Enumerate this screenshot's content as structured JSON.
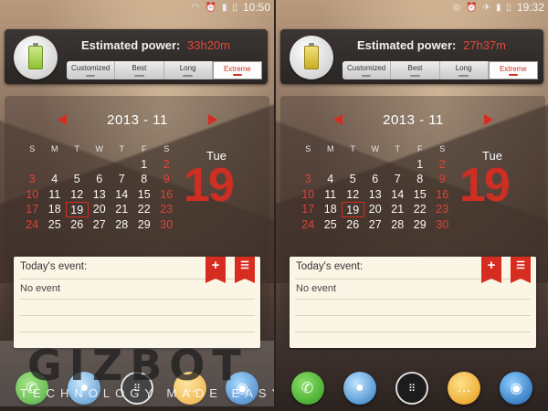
{
  "screens": [
    {
      "status": {
        "time": "10:50"
      },
      "power": {
        "label": "Estimated power:",
        "value": "33h20m",
        "battery_color": "green"
      },
      "modes": [
        "Customized",
        "Best",
        "Long",
        "Extreme"
      ],
      "active_mode": "Extreme",
      "calendar": {
        "month_label": "2013 - 11",
        "weekdays": [
          "S",
          "M",
          "T",
          "W",
          "T",
          "F",
          "S"
        ],
        "day_name": "Tue",
        "day_number": "19"
      },
      "events": {
        "title": "Today's event:",
        "empty_text": "No event",
        "add_icon": "+",
        "list_icon": "☰"
      }
    },
    {
      "status": {
        "time": "19:32"
      },
      "power": {
        "label": "Estimated power:",
        "value": "27h37m",
        "battery_color": "yellow"
      },
      "modes": [
        "Customized",
        "Best",
        "Long",
        "Extreme"
      ],
      "active_mode": "Extreme",
      "calendar": {
        "month_label": "2013 - 11",
        "weekdays": [
          "S",
          "M",
          "T",
          "W",
          "T",
          "F",
          "S"
        ],
        "day_name": "Tue",
        "day_number": "19"
      },
      "events": {
        "title": "Today's event:",
        "empty_text": "No event",
        "add_icon": "+",
        "list_icon": "☰"
      }
    }
  ],
  "calendar_days": [
    [
      "",
      "",
      "",
      "",
      "",
      "1",
      "2"
    ],
    [
      "3",
      "4",
      "5",
      "6",
      "7",
      "8",
      "9"
    ],
    [
      "10",
      "11",
      "12",
      "13",
      "14",
      "15",
      "16"
    ],
    [
      "17",
      "18",
      "19",
      "20",
      "21",
      "22",
      "23"
    ],
    [
      "24",
      "25",
      "26",
      "27",
      "28",
      "29",
      "30"
    ]
  ],
  "dock_icons": [
    "phone-icon",
    "contacts-icon",
    "apps-icon",
    "sms-icon",
    "browser-icon"
  ],
  "watermark": {
    "logo": "GIZBOT",
    "tagline": "TECHNOLOGY MADE EASY"
  },
  "colors": {
    "accent_red": "#d62d20",
    "weekend_red": "#e04236"
  }
}
